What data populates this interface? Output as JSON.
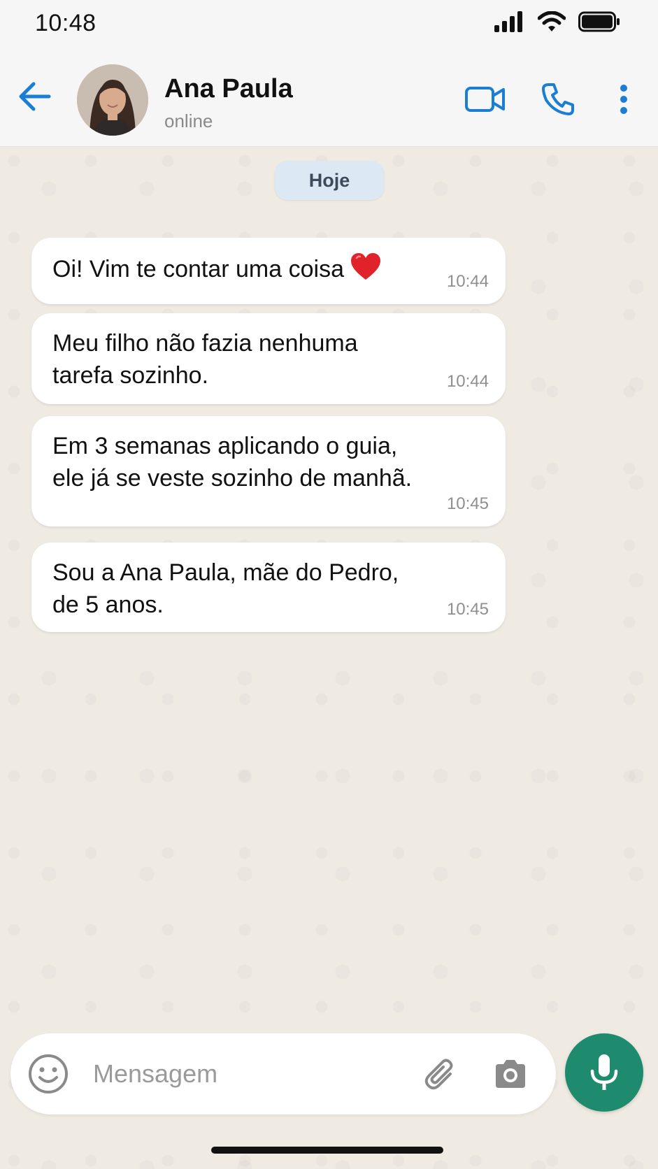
{
  "status_bar": {
    "time": "10:48"
  },
  "header": {
    "contact_name": "Ana Paula",
    "contact_status": "online"
  },
  "chat": {
    "date_label": "Hoje",
    "messages": [
      {
        "text": "Oi! Vim te contar uma coisa",
        "emoji": "red-heart",
        "time": "10:44"
      },
      {
        "text": "Meu filho não fazia nenhuma\ntarefa sozinho.",
        "time": "10:44"
      },
      {
        "text": "Em 3 semanas aplicando o guia,\nele já se veste sozinho de manhã.",
        "time": "10:45"
      },
      {
        "text": "Sou a Ana Paula, mãe do Pedro,\nde 5 anos.",
        "time": "10:45"
      }
    ]
  },
  "composer": {
    "placeholder": "Mensagem"
  },
  "colors": {
    "accent": "#1a7fd4",
    "mic_button": "#1e8a6e",
    "chat_background": "#efeae2",
    "date_pill": "#dde8f5"
  },
  "icons": [
    "back-arrow-icon",
    "video-call-icon",
    "phone-icon",
    "more-vertical-icon",
    "emoji-icon",
    "paperclip-icon",
    "camera-icon",
    "microphone-icon",
    "signal-icon",
    "wifi-icon",
    "battery-icon"
  ]
}
